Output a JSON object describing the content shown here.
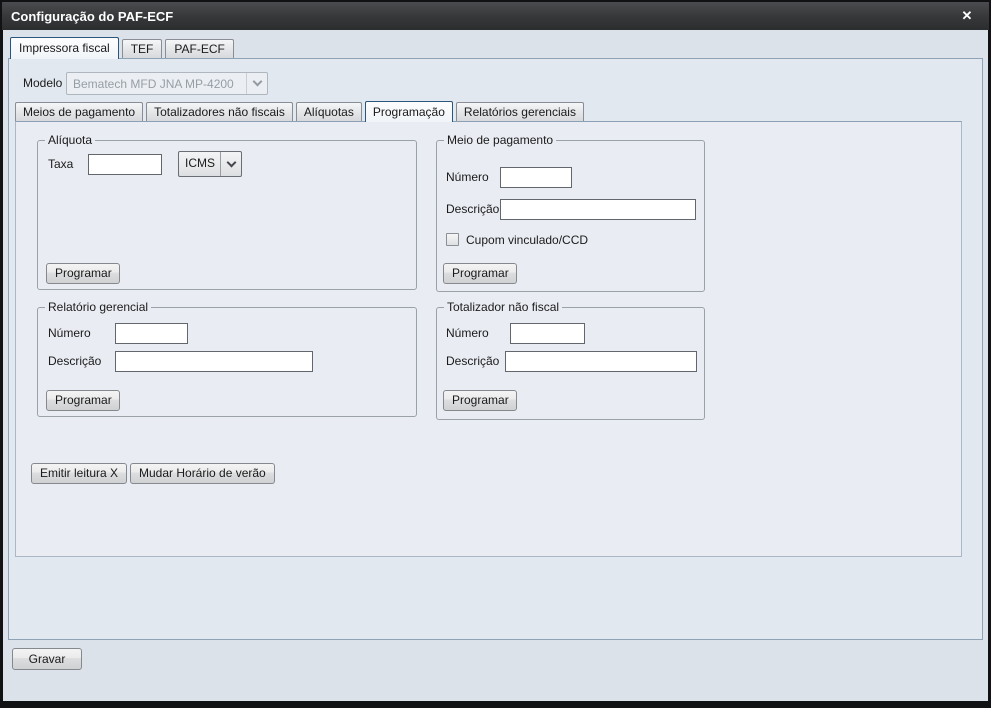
{
  "window": {
    "title": "Configuração do PAF-ECF"
  },
  "icons": {
    "close": "✕"
  },
  "main_tabs": [
    {
      "label": "Impressora fiscal",
      "selected": true
    },
    {
      "label": "TEF",
      "selected": false
    },
    {
      "label": "PAF-ECF",
      "selected": false
    }
  ],
  "modelo": {
    "label": "Modelo",
    "value": "Bematech MFD JNA MP-4200",
    "disabled": true
  },
  "inner_tabs": [
    {
      "label": "Meios de pagamento",
      "selected": false
    },
    {
      "label": "Totalizadores não fiscais",
      "selected": false
    },
    {
      "label": "Alíquotas",
      "selected": false
    },
    {
      "label": "Programação",
      "selected": true
    },
    {
      "label": "Relatórios gerenciais",
      "selected": false
    }
  ],
  "groups": {
    "aliquota": {
      "legend": "Alíquota",
      "taxa_label": "Taxa",
      "taxa_value": "",
      "tipo_selected": "ICMS",
      "programar_label": "Programar"
    },
    "meio_pagamento": {
      "legend": "Meio de pagamento",
      "numero_label": "Número",
      "numero_value": "",
      "descricao_label": "Descrição",
      "descricao_value": "",
      "checkbox_label": "Cupom vinculado/CCD",
      "checkbox_checked": false,
      "programar_label": "Programar"
    },
    "relatorio_gerencial": {
      "legend": "Relatório gerencial",
      "numero_label": "Número",
      "numero_value": "",
      "descricao_label": "Descrição",
      "descricao_value": "",
      "programar_label": "Programar"
    },
    "totalizador_nao_fiscal": {
      "legend": "Totalizador não fiscal",
      "numero_label": "Número",
      "numero_value": "",
      "descricao_label": "Descrição",
      "descricao_value": "",
      "programar_label": "Programar"
    }
  },
  "actions": {
    "emitir_leitura_x": "Emitir leitura X",
    "mudar_horario_verao": "Mudar Horário de verão",
    "gravar": "Gravar"
  }
}
